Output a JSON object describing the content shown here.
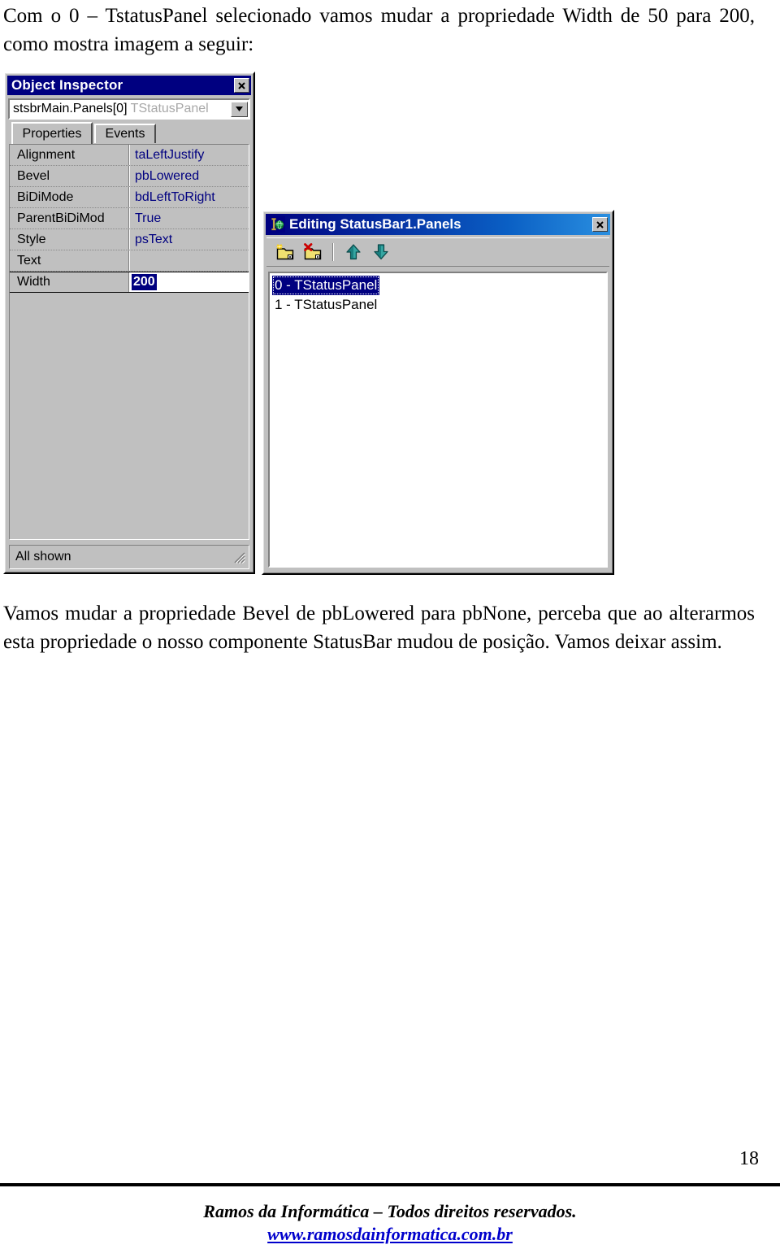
{
  "document": {
    "intro_paragraph": "Com o 0 – TstatusPanel selecionado vamos mudar a propriedade Width de 50 para 200, como mostra imagem a seguir:",
    "after_paragraph": "Vamos mudar a propriedade Bevel de pbLowered para pbNone, perceba que ao alterarmos esta propriedade o nosso componente StatusBar mudou de posição. Vamos deixar assim.",
    "page_number": "18",
    "footer_copyright": "Ramos da Informática – Todos direitos reservados.",
    "footer_url": "www.ramosdainformatica.com.br"
  },
  "object_inspector": {
    "title": "Object Inspector",
    "close_label": "close-icon",
    "combo": {
      "object_name": "stsbrMain.Panels[0]",
      "class_name": "TStatusPanel",
      "dropdown_icon": "chevron-down-icon"
    },
    "tabs": [
      {
        "label": "Properties",
        "active": true
      },
      {
        "label": "Events",
        "active": false
      }
    ],
    "properties": [
      {
        "name": "Alignment",
        "value": "taLeftJustify",
        "selected": false
      },
      {
        "name": "Bevel",
        "value": "pbLowered",
        "selected": false
      },
      {
        "name": "BiDiMode",
        "value": "bdLeftToRight",
        "selected": false
      },
      {
        "name": "ParentBiDiMod",
        "value": "True",
        "selected": false
      },
      {
        "name": "Style",
        "value": "psText",
        "selected": false
      },
      {
        "name": "Text",
        "value": "",
        "selected": false
      },
      {
        "name": "Width",
        "value": "200",
        "selected": true
      }
    ],
    "status_text": "All shown",
    "resize_grip": "resize-grip-icon"
  },
  "panels_editor": {
    "title": "Editing StatusBar1.Panels",
    "title_icon": "collection-editor-icon",
    "close_label": "close-icon",
    "toolbar": [
      {
        "name": "add-item-button",
        "icon": "new-item-icon",
        "title": "Add"
      },
      {
        "name": "delete-item-button",
        "icon": "delete-item-icon",
        "title": "Delete"
      },
      {
        "name": "move-up-button",
        "icon": "arrow-up-icon",
        "title": "Move Up"
      },
      {
        "name": "move-down-button",
        "icon": "arrow-down-icon",
        "title": "Move Down"
      }
    ],
    "items": [
      {
        "label": "0 - TStatusPanel",
        "selected": true
      },
      {
        "label": "1 - TStatusPanel",
        "selected": false
      }
    ]
  },
  "colors": {
    "titlebar_navy": "#000080",
    "dialog_titlebar_gradient_start": "#000080",
    "dialog_titlebar_gradient_end": "#2a8fe0",
    "window_face": "#c0c0c0",
    "property_value_blue": "#000080",
    "selection_navy": "#000080",
    "link_blue": "#0000cc",
    "toolbar_arrow_teal": "#1a7a7a",
    "icon_yellow": "#f0e060",
    "icon_red": "#cc0000"
  }
}
